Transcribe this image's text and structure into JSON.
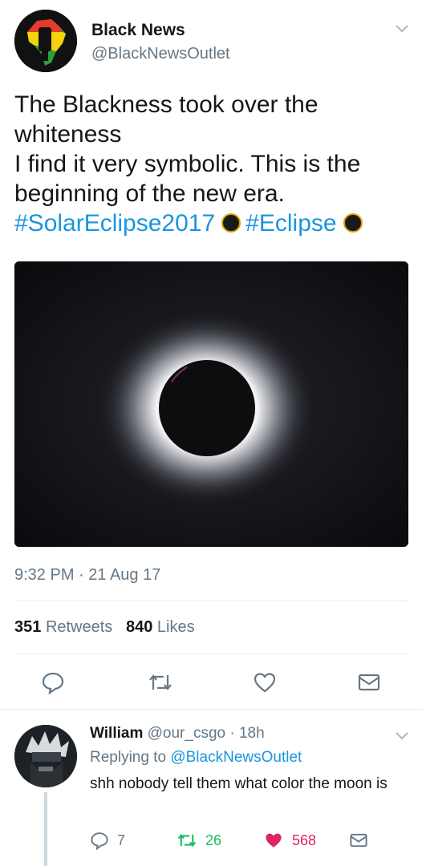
{
  "tweet": {
    "author_name": "Black News",
    "author_handle": "@BlackNewsOutlet",
    "text_lines": [
      "The Blackness took over the",
      "whiteness",
      "I find it very symbolic. This is the",
      "beginning of the new era."
    ],
    "hashtags": [
      "#SolarEclipse2017",
      "#Eclipse"
    ],
    "timestamp": "9:32 PM · 21 Aug 17",
    "retweets_count": "351",
    "retweets_label": "Retweets",
    "likes_count": "840",
    "likes_label": "Likes",
    "actions": [
      "reply-icon",
      "retweet-icon",
      "like-icon",
      "dm-icon"
    ]
  },
  "reply": {
    "name": "William",
    "handle": "@our_csgo",
    "time": "· 18h",
    "replying_prefix": "Replying to",
    "replying_handle": "@BlackNewsOutlet",
    "text": "shh nobody tell them what color the moon is",
    "reply_count": "7",
    "retweet_count": "26",
    "like_count": "568"
  },
  "colors": {
    "link": "#1b95e0",
    "secondary_text": "#657786",
    "retweet_green": "#17bf63",
    "like_red": "#e0245e",
    "divider": "#e6ecf0"
  }
}
